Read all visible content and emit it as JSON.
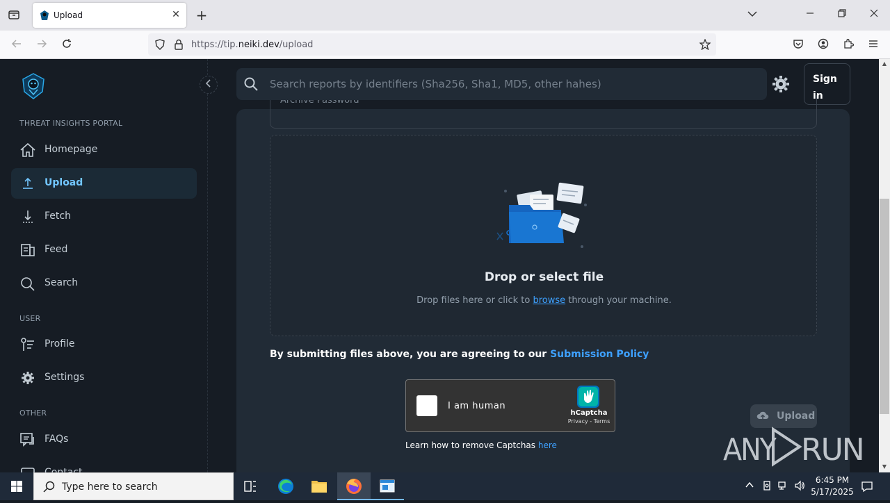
{
  "browser": {
    "tab_title": "Upload",
    "url_prefix": "https://tip.",
    "url_domain": "neiki.dev",
    "url_path": "/upload"
  },
  "sidebar": {
    "section_main": "THREAT INSIGHTS PORTAL",
    "section_user": "USER",
    "section_other": "OTHER",
    "items": [
      {
        "label": "Homepage",
        "icon": "home-icon"
      },
      {
        "label": "Upload",
        "icon": "upload-icon"
      },
      {
        "label": "Fetch",
        "icon": "fetch-icon"
      },
      {
        "label": "Feed",
        "icon": "feed-icon"
      },
      {
        "label": "Search",
        "icon": "search-icon"
      },
      {
        "label": "Profile",
        "icon": "profile-icon"
      },
      {
        "label": "Settings",
        "icon": "gear-icon"
      },
      {
        "label": "FAQs",
        "icon": "faq-icon"
      },
      {
        "label": "Contact",
        "icon": "contact-icon"
      }
    ],
    "active_item": "Upload"
  },
  "header": {
    "search_placeholder": "Search reports by identifiers (Sha256, Sha1, MD5, other hahes)",
    "signin_label": "Sign in"
  },
  "upload": {
    "archive_password_label": "Archive Password",
    "drop_title": "Drop or select file",
    "drop_sub_before": "Drop files here or click to ",
    "drop_sub_link": "browse",
    "drop_sub_after": " through your machine.",
    "policy_text": "By submitting files above, you are agreeing to our ",
    "policy_link": "Submission Policy",
    "upload_button": "Upload"
  },
  "captcha": {
    "label": "I am human",
    "brand": "hCaptcha",
    "terms": "Privacy - Terms",
    "learn_text": "Learn how to remove Captchas ",
    "learn_link": "here"
  },
  "watermark": "ANY RUN",
  "taskbar": {
    "search_placeholder": "Type here to search",
    "time": "6:45 PM",
    "date": "5/17/2025"
  },
  "colors": {
    "background": "#161c24",
    "card": "#212b36",
    "accent": "#3ea1ff",
    "active_nav": "#72c6ff"
  }
}
